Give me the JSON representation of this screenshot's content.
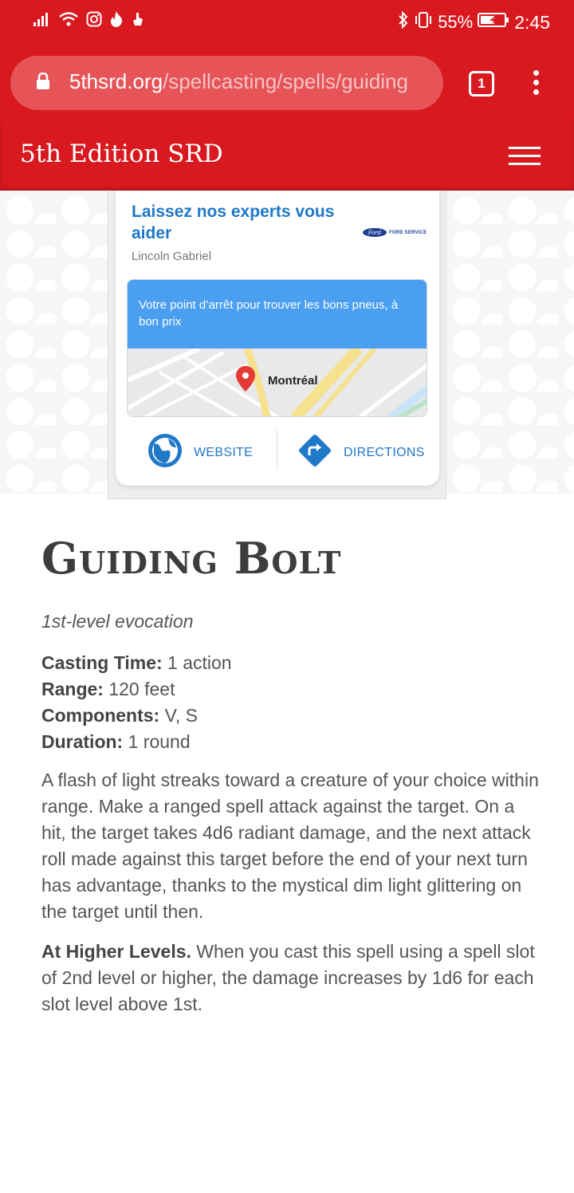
{
  "status_bar": {
    "battery_percent": "55%",
    "time": "2:45"
  },
  "browser": {
    "url_domain": "5thsrd.org",
    "url_path": "/spellcasting/spells/guiding",
    "tab_count": "1"
  },
  "site": {
    "title": "5th Edition SRD"
  },
  "ad": {
    "headline": "Laissez nos experts vous aider",
    "advertiser": "Lincoln Gabriel",
    "logo_text": "Ford",
    "logo_caption": "FORD SERVICE",
    "promo_text": "Votre point d’arrêt pour trouver les bons pneus, à bon prix",
    "map_label": "Montréal",
    "website_label": "WEBSITE",
    "directions_label": "DIRECTIONS"
  },
  "spell": {
    "title": "Guiding Bolt",
    "school": "1st-level evocation",
    "casting_time_label": "Casting Time:",
    "casting_time_value": " 1 action",
    "range_label": "Range:",
    "range_value": " 120 feet",
    "components_label": "Components:",
    "components_value": " V, S",
    "duration_label": "Duration:",
    "duration_value": " 1 round",
    "description": "A flash of light streaks toward a creature of your choice within range. Make a ranged spell attack against the target. On a hit, the target takes 4d6 radiant damage, and the next attack roll made against this target before the end of your next turn has advantage, thanks to the mystical dim light glittering on the target until then.",
    "higher_levels_label": "At Higher Levels.",
    "higher_levels_text": " When you cast this spell using a spell slot of 2nd level or higher, the damage increases by 1d6 for each slot level above 1st."
  }
}
